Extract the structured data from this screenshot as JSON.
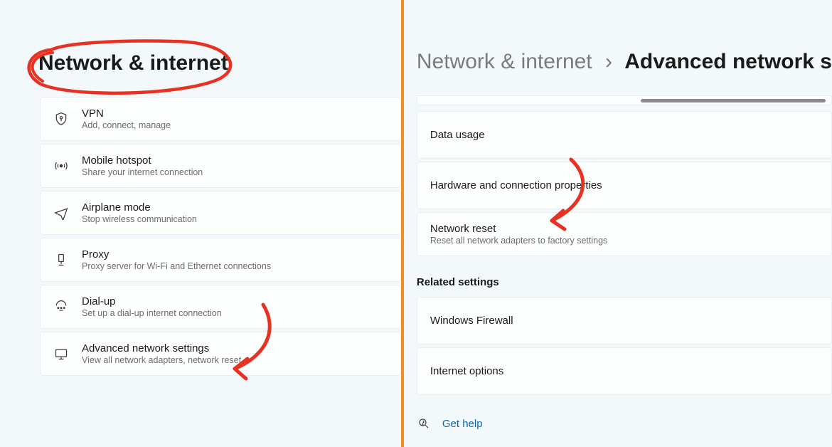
{
  "left_panel": {
    "title": "Network & internet",
    "items": [
      {
        "title": "VPN",
        "desc": "Add, connect, manage"
      },
      {
        "title": "Mobile hotspot",
        "desc": "Share your internet connection"
      },
      {
        "title": "Airplane mode",
        "desc": "Stop wireless communication"
      },
      {
        "title": "Proxy",
        "desc": "Proxy server for Wi-Fi and Ethernet connections"
      },
      {
        "title": "Dial-up",
        "desc": "Set up a dial-up internet connection"
      },
      {
        "title": "Advanced network settings",
        "desc": "View all network adapters, network reset"
      }
    ]
  },
  "right_panel": {
    "breadcrumb_parent": "Network & internet",
    "breadcrumb_sep": "›",
    "breadcrumb_current": "Advanced network s",
    "items": [
      {
        "title": "Data usage",
        "desc": ""
      },
      {
        "title": "Hardware and connection properties",
        "desc": ""
      },
      {
        "title": "Network reset",
        "desc": "Reset all network adapters to factory settings"
      }
    ],
    "related_heading": "Related settings",
    "related_items": [
      {
        "title": "Windows Firewall"
      },
      {
        "title": "Internet options"
      }
    ],
    "help_label": "Get help"
  },
  "annotation_color": "#e73223"
}
